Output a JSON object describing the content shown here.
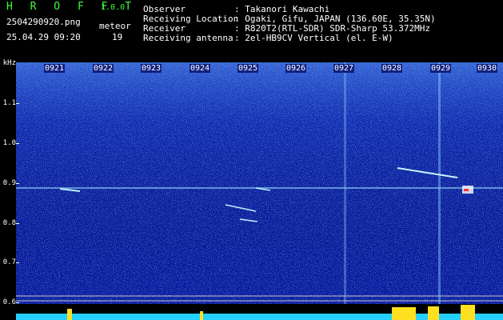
{
  "app": {
    "title": "H R O F F T",
    "version": "1.0.0"
  },
  "header": {
    "filename": "2504290920.png",
    "datetime": "25.04.29 09:20",
    "meteor_label": "meteor",
    "meteor_count": "19",
    "info_labels": [
      "Observer",
      "Receiving Location",
      "Receiver",
      "Receiving antenna"
    ],
    "info_values": [
      ": Takanori Kawachi",
      ": Ogaki, Gifu, JAPAN (136.60E, 35.35N)",
      ": R820T2(RTL-SDR) SDR-Sharp 53.372MHz",
      ": 2el-HB9CV Vertical (el. E-W)"
    ]
  },
  "spectrogram": {
    "y_unit": "kHz",
    "y_labels": [
      "1.1",
      "1.0",
      "0.9",
      "0.8",
      "0.7",
      "0.6"
    ],
    "x_labels": [
      "0921",
      "0922",
      "0923",
      "0924",
      "0925",
      "0926",
      "0927",
      "0928",
      "0929",
      "0930"
    ],
    "colors": {
      "background": "#071a9e",
      "signal": "#9fe8ff",
      "strong": "#ffffff",
      "hot": "#ff3030",
      "baseline": "#24d0ff",
      "peak": "#ffe020"
    }
  }
}
